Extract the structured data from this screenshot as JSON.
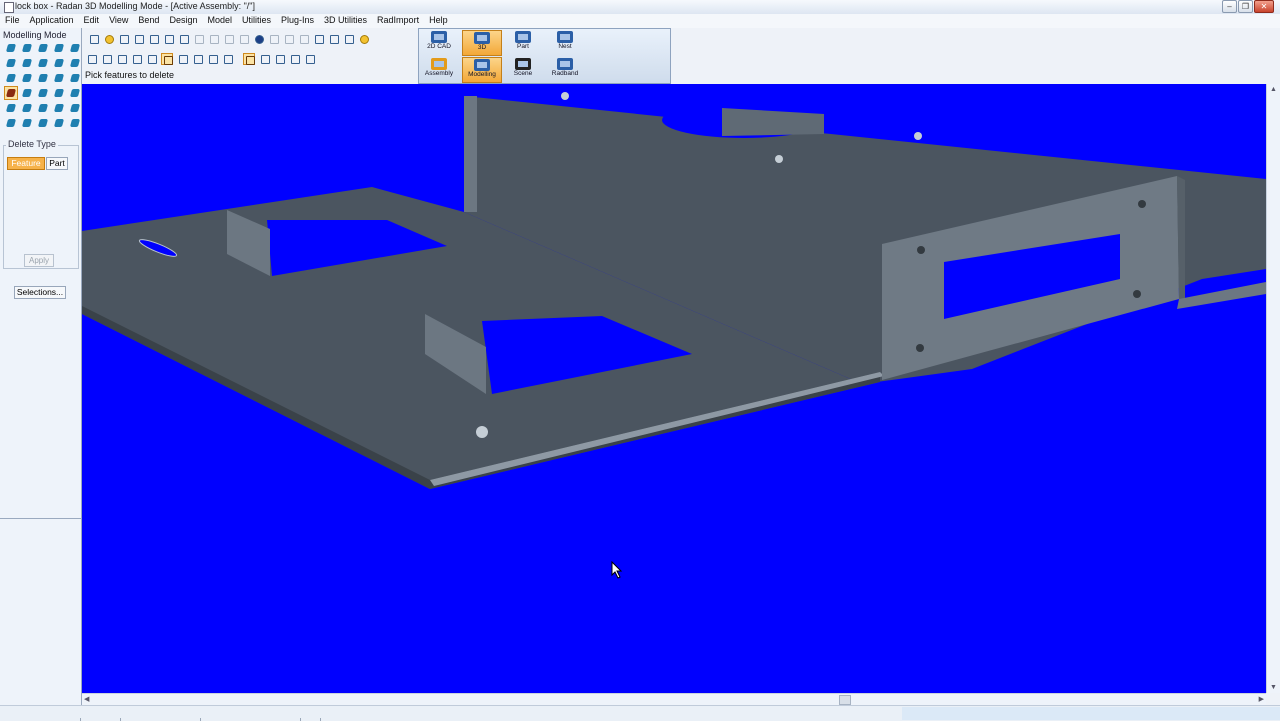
{
  "window": {
    "title": "lock box - Radan 3D Modelling Mode - [Active Assembly: \"/\"]"
  },
  "menu": [
    "File",
    "Application",
    "Edit",
    "View",
    "Bend",
    "Design",
    "Model",
    "Utilities",
    "Plug-Ins",
    "3D Utilities",
    "RadImport",
    "Help"
  ],
  "left_panel": {
    "mode_label": "Modelling Mode",
    "delete_type": {
      "title": "Delete Type",
      "feature": "Feature",
      "part": "Part",
      "selected": "Feature"
    },
    "apply": "Apply",
    "selections": "Selections..."
  },
  "status_prompt": "Pick features to delete",
  "ribbon": {
    "top": [
      {
        "label": "2D CAD"
      },
      {
        "label": "3D"
      },
      {
        "label": "Part"
      },
      {
        "label": "Nest"
      }
    ],
    "bottom": [
      {
        "label": "Assembly"
      },
      {
        "label": "Modelling"
      },
      {
        "label": "Scene"
      },
      {
        "label": "Radband"
      }
    ],
    "active": [
      "3D",
      "Modelling"
    ]
  },
  "colors": {
    "viewport_background": "#0000ff",
    "part_face": "#4b5560",
    "part_face_light": "#6c7782",
    "active_highlight": "#f6b24a"
  }
}
